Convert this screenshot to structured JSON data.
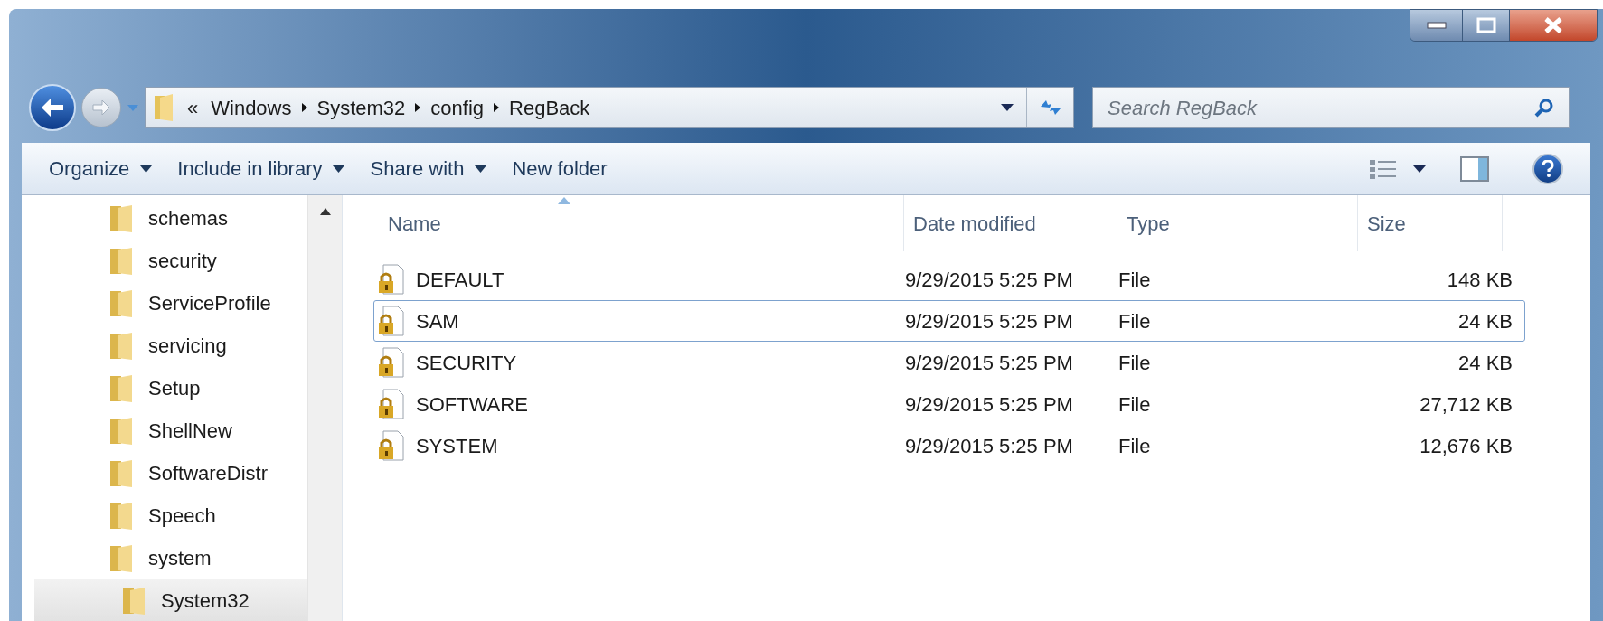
{
  "address": {
    "crumbs": [
      "Windows",
      "System32",
      "config",
      "RegBack"
    ],
    "overflow": "«"
  },
  "search": {
    "placeholder": "Search RegBack"
  },
  "toolbar": [
    {
      "label": "Organize",
      "dropdown": true
    },
    {
      "label": "Include in library",
      "dropdown": true
    },
    {
      "label": "Share with",
      "dropdown": true
    },
    {
      "label": "New folder",
      "dropdown": false
    }
  ],
  "nav": {
    "items": [
      {
        "label": "schemas",
        "selected": false
      },
      {
        "label": "security",
        "selected": false
      },
      {
        "label": "ServiceProfile",
        "selected": false
      },
      {
        "label": "servicing",
        "selected": false
      },
      {
        "label": "Setup",
        "selected": false
      },
      {
        "label": "ShellNew",
        "selected": false
      },
      {
        "label": "SoftwareDistr",
        "selected": false
      },
      {
        "label": "Speech",
        "selected": false
      },
      {
        "label": "system",
        "selected": false
      },
      {
        "label": "System32",
        "selected": true
      }
    ]
  },
  "table": {
    "columns": [
      "Name",
      "Date modified",
      "Type",
      "Size"
    ],
    "rows": [
      {
        "name": "DEFAULT",
        "date": "9/29/2015 5:25 PM",
        "type": "File",
        "size": "148 KB",
        "focused": false
      },
      {
        "name": "SAM",
        "date": "9/29/2015 5:25 PM",
        "type": "File",
        "size": "24 KB",
        "focused": true
      },
      {
        "name": "SECURITY",
        "date": "9/29/2015 5:25 PM",
        "type": "File",
        "size": "24 KB",
        "focused": false
      },
      {
        "name": "SOFTWARE",
        "date": "9/29/2015 5:25 PM",
        "type": "File",
        "size": "27,712 KB",
        "focused": false
      },
      {
        "name": "SYSTEM",
        "date": "9/29/2015 5:25 PM",
        "type": "File",
        "size": "12,676 KB",
        "focused": false
      }
    ]
  }
}
